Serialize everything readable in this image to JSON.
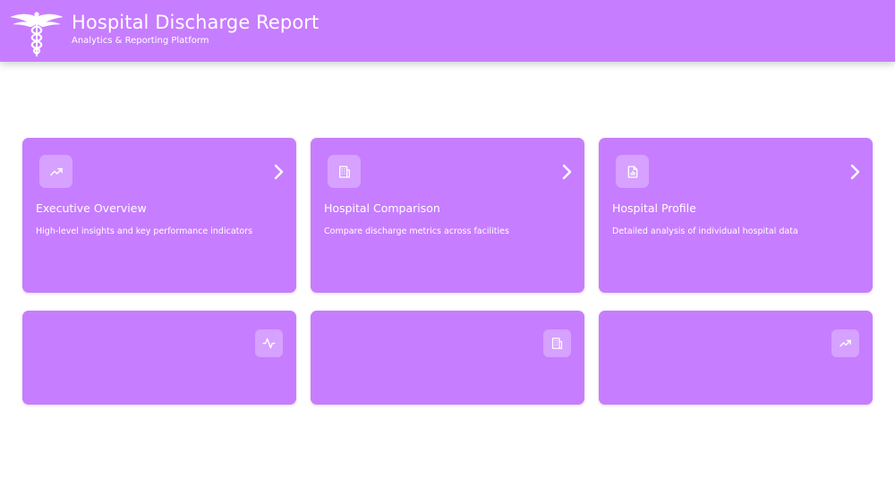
{
  "header": {
    "title": "Hospital Discharge Report",
    "subtitle": "Analytics & Reporting Platform",
    "logo_icon": "caduceus-icon"
  },
  "cards": [
    {
      "title": "Executive Overview",
      "description": "High-level insights and key performance indicators",
      "icon": "trending-up-icon"
    },
    {
      "title": "Hospital Comparison",
      "description": "Compare discharge metrics across facilities",
      "icon": "hospital-building-icon"
    },
    {
      "title": "Hospital Profile",
      "description": "Detailed analysis of individual hospital data",
      "icon": "document-chart-icon"
    }
  ],
  "secondary_cards": [
    {
      "icon": "activity-pulse-icon"
    },
    {
      "icon": "hospital-building-icon"
    },
    {
      "icon": "trending-up-icon"
    }
  ],
  "colors": {
    "primary": "#c77dff",
    "text": "#ffffff",
    "background": "#ffffff"
  }
}
